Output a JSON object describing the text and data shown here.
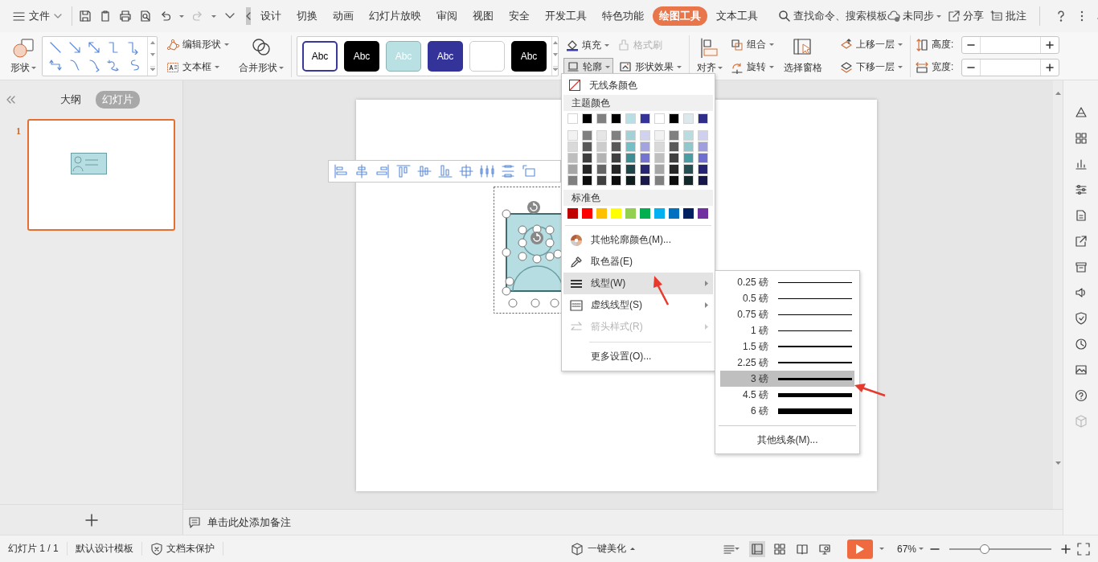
{
  "menu_bar": {
    "file_label": "文件",
    "tabs": [
      {
        "label": "设计",
        "selected": false
      },
      {
        "label": "切换",
        "selected": false
      },
      {
        "label": "动画",
        "selected": false
      },
      {
        "label": "幻灯片放映",
        "selected": false
      },
      {
        "label": "审阅",
        "selected": false
      },
      {
        "label": "视图",
        "selected": false
      },
      {
        "label": "安全",
        "selected": false
      },
      {
        "label": "开发工具",
        "selected": false
      },
      {
        "label": "特色功能",
        "selected": false
      },
      {
        "label": "绘图工具",
        "selected": true
      },
      {
        "label": "文本工具",
        "selected": false
      }
    ],
    "search": {
      "label": "查找命令、搜索模板"
    },
    "actions": [
      {
        "label": "未同步",
        "kind": "sync"
      },
      {
        "label": "分享",
        "kind": "share"
      },
      {
        "label": "批注",
        "kind": "comment"
      }
    ]
  },
  "ribbon": {
    "shape": "形状",
    "edit_shape": "编辑形状",
    "text_box": "文本框",
    "merge_shapes": "合并形状",
    "style_presets": [
      {
        "label": "Abc",
        "kind": "outlined"
      },
      {
        "label": "Abc",
        "kind": "dark"
      },
      {
        "label": "Abc",
        "kind": "teal"
      },
      {
        "label": "Abc",
        "kind": "navy"
      },
      {
        "kind": "blank"
      },
      {
        "label": "Abc",
        "kind": "dark"
      }
    ],
    "fill": "填充",
    "format_painter": {
      "label": "格式刷",
      "disabled": true
    },
    "outline": {
      "label": "轮廓",
      "open": true
    },
    "shape_effects": "形状效果",
    "align": "对齐",
    "group": "组合",
    "rotate": "旋转",
    "selection_pane": "选择窗格",
    "bring_forward": "上移一层",
    "send_backward": "下移一层",
    "height_label": "高度:",
    "width_label": "宽度:"
  },
  "panel": {
    "tabs": [
      {
        "label": "大纲",
        "selected": false
      },
      {
        "label": "幻灯片",
        "selected": true
      }
    ],
    "slides": [
      {
        "number": "1",
        "selected": true
      }
    ]
  },
  "notes": {
    "placeholder": "单击此处添加备注"
  },
  "outline_menu": {
    "no_color": "无线条颜色",
    "theme_header": "主题颜色",
    "theme_colors": [
      {
        "color": "#ffffff",
        "shades": [
          {
            "color": "#f2f2f2"
          },
          {
            "color": "#d9d9d9"
          },
          {
            "color": "#bfbfbf"
          },
          {
            "color": "#a6a6a6"
          },
          {
            "color": "#808080"
          }
        ]
      },
      {
        "color": "#000000",
        "shades": [
          {
            "color": "#7f7f7f"
          },
          {
            "color": "#595959"
          },
          {
            "color": "#3f3f3f"
          },
          {
            "color": "#262626"
          },
          {
            "color": "#0d0d0d"
          }
        ]
      },
      {
        "color": "#808080",
        "shades": [
          {
            "color": "#e6e6e6"
          },
          {
            "color": "#cccccc"
          },
          {
            "color": "#b3b3b3"
          },
          {
            "color": "#666666"
          },
          {
            "color": "#404040"
          }
        ]
      },
      {
        "color": "#000000",
        "shades": [
          {
            "color": "#808080"
          },
          {
            "color": "#595959"
          },
          {
            "color": "#404040"
          },
          {
            "color": "#262626"
          },
          {
            "color": "#0d0d0d"
          }
        ]
      },
      {
        "color": "#b8dfe3",
        "shades": [
          {
            "color": "#a2d2d7"
          },
          {
            "color": "#74bfc6"
          },
          {
            "color": "#3f8e94"
          },
          {
            "color": "#1f474a"
          },
          {
            "color": "#101d1f"
          }
        ]
      },
      {
        "color": "#333399",
        "shades": [
          {
            "color": "#d1d1f0"
          },
          {
            "color": "#a3a3e0"
          },
          {
            "color": "#7575d1"
          },
          {
            "color": "#262673"
          },
          {
            "color": "#1a1a4d"
          }
        ]
      },
      {
        "color": "#ffffff",
        "shades": [
          {
            "color": "#f2f2f2"
          },
          {
            "color": "#d9d9d9"
          },
          {
            "color": "#bfbfbf"
          },
          {
            "color": "#a6a6a6"
          },
          {
            "color": "#808080"
          }
        ]
      },
      {
        "color": "#000000",
        "shades": [
          {
            "color": "#808080"
          },
          {
            "color": "#595959"
          },
          {
            "color": "#404040"
          },
          {
            "color": "#262626"
          },
          {
            "color": "#0d0d0d"
          }
        ]
      },
      {
        "color": "#dbe8ec",
        "shades": [
          {
            "color": "#b8dcdf"
          },
          {
            "color": "#8fc7cc"
          },
          {
            "color": "#4a9da3"
          },
          {
            "color": "#254f52"
          },
          {
            "color": "#12282a"
          }
        ]
      },
      {
        "color": "#2e2e8a",
        "shades": [
          {
            "color": "#cfcff0"
          },
          {
            "color": "#9f9fe0"
          },
          {
            "color": "#6f6fd1"
          },
          {
            "color": "#252573"
          },
          {
            "color": "#18184d"
          }
        ]
      }
    ],
    "standard_header": "标准色",
    "standard_colors": [
      {
        "color": "#c00000"
      },
      {
        "color": "#ff0000"
      },
      {
        "color": "#ffc000"
      },
      {
        "color": "#ffff00"
      },
      {
        "color": "#92d050"
      },
      {
        "color": "#00b050"
      },
      {
        "color": "#00b0f0"
      },
      {
        "color": "#0070c0"
      },
      {
        "color": "#002060"
      },
      {
        "color": "#7030a0"
      }
    ],
    "items": [
      {
        "label": "其他轮廓颜色(M)...",
        "kind": "palette",
        "submenu": false,
        "disabled": false,
        "selected": false
      },
      {
        "label": "取色器(E)",
        "kind": "eyedropper",
        "submenu": false,
        "disabled": false,
        "selected": false
      },
      {
        "label": "线型(W)",
        "kind": "weight",
        "submenu": true,
        "disabled": false,
        "selected": true
      },
      {
        "label": "虚线线型(S)",
        "kind": "dash",
        "submenu": true,
        "disabled": false,
        "selected": false
      },
      {
        "label": "箭头样式(R)",
        "kind": "arrows",
        "submenu": true,
        "disabled": true,
        "selected": false
      },
      {
        "label": "更多设置(O)...",
        "kind": "more",
        "submenu": false,
        "disabled": false,
        "selected": false
      }
    ]
  },
  "line_weight_menu": {
    "items": [
      {
        "label": "0.25 磅",
        "selected": false
      },
      {
        "label": "0.5 磅",
        "selected": false
      },
      {
        "label": "0.75 磅",
        "selected": false
      },
      {
        "label": "1 磅",
        "selected": false
      },
      {
        "label": "1.5 磅",
        "selected": false
      },
      {
        "label": "2.25 磅",
        "selected": false
      },
      {
        "label": "3 磅",
        "selected": true
      },
      {
        "label": "4.5 磅",
        "selected": false
      },
      {
        "label": "6 磅",
        "selected": false
      }
    ],
    "more": "其他线条(M)..."
  },
  "status_bar": {
    "slide_counter": "幻灯片 1 / 1",
    "template": "默认设计模板",
    "protection": "文档未保护",
    "beautify": "一键美化",
    "zoom": {
      "label": "67%",
      "level": 0.35
    }
  }
}
